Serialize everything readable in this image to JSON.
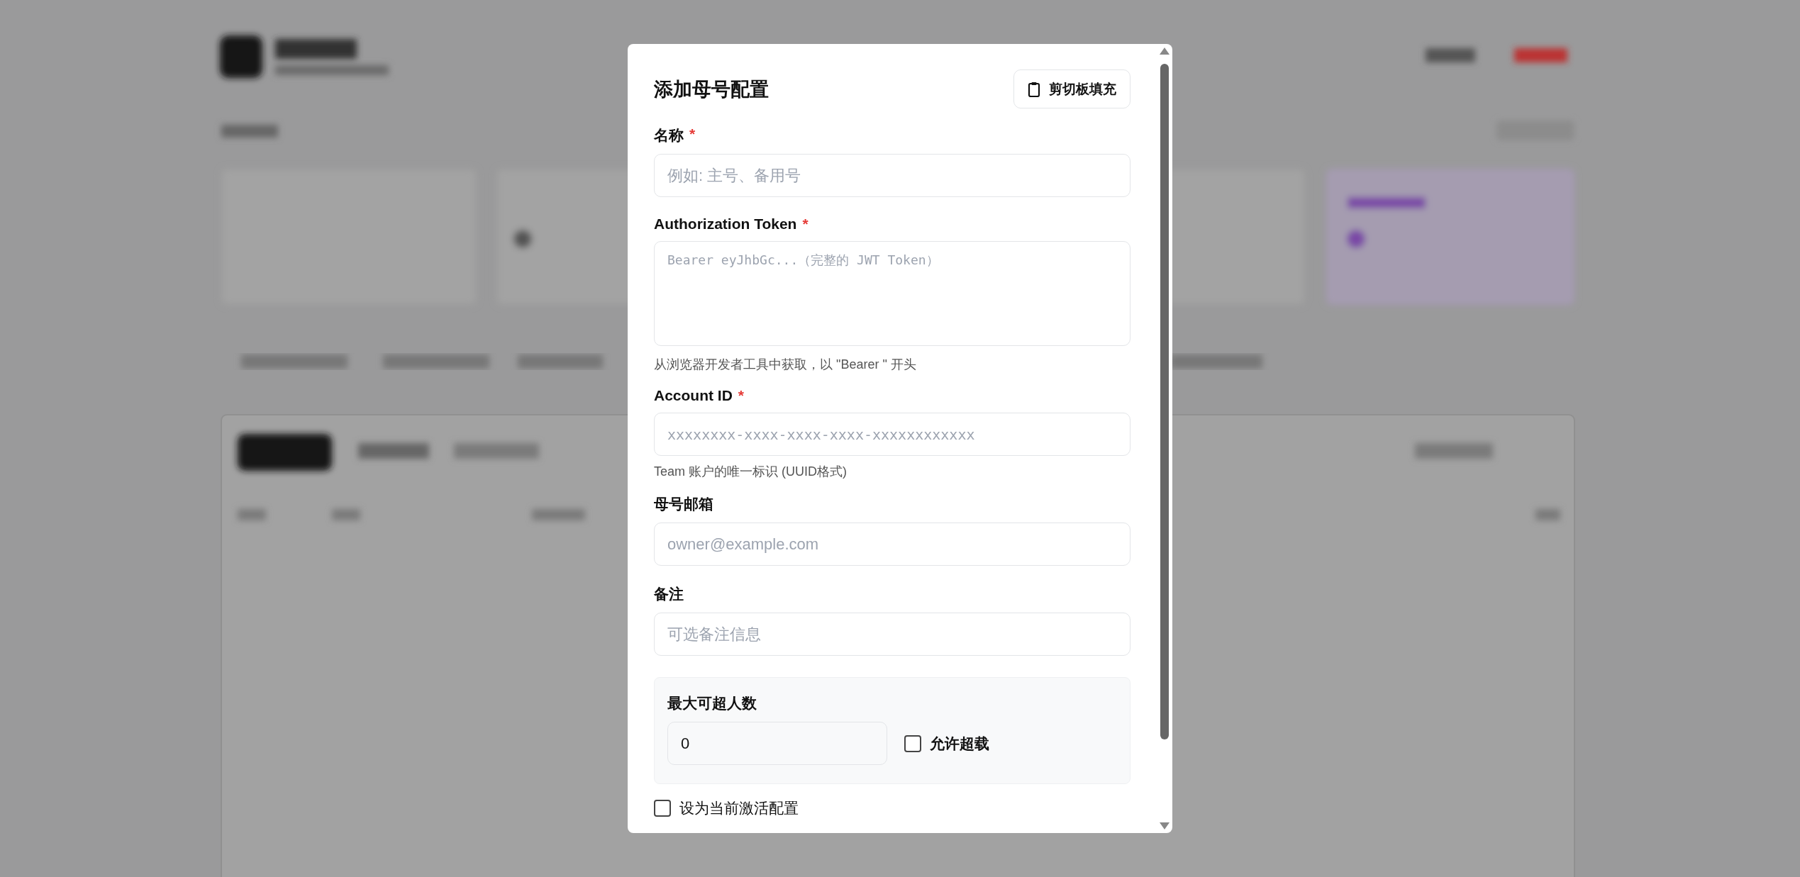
{
  "dialog": {
    "title": "添加母号配置",
    "clipboard_button": {
      "label": "剪切板填充"
    },
    "fields": [
      {
        "kind": "text",
        "label": "名称",
        "marker": "*",
        "placeholder": "例如: 主号、备用号"
      },
      {
        "kind": "textarea",
        "label": "Authorization Token",
        "marker": "*",
        "placeholder": "Bearer eyJhbGc...（完整的 JWT Token）",
        "hint": "从浏览器开发者工具中获取，以 \"Bearer \" 开头"
      },
      {
        "kind": "mono",
        "label": "Account ID",
        "marker": "*",
        "placeholder": "xxxxxxxx-xxxx-xxxx-xxxx-xxxxxxxxxxxx",
        "hint": "Team 账户的唯一标识 (UUID格式)"
      },
      {
        "kind": "text",
        "label": "母号邮箱",
        "placeholder": "owner@example.com"
      },
      {
        "kind": "text",
        "label": "备注",
        "placeholder": "可选备注信息"
      }
    ],
    "limit": {
      "label": "最大可超人数",
      "value": "0",
      "overload": {
        "label": "允许超载",
        "checked": false
      }
    },
    "active": {
      "label": "设为当前激活配置",
      "checked": false
    }
  }
}
